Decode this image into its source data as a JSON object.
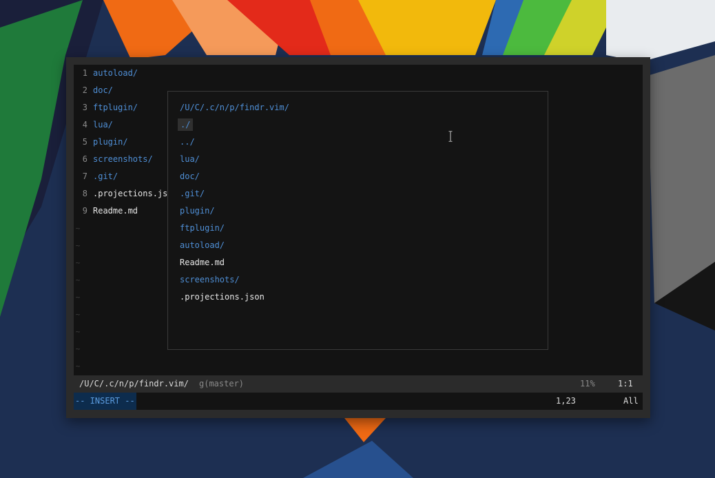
{
  "buffer": {
    "lines": [
      {
        "num": "1",
        "text": "autoload/",
        "kind": "dir"
      },
      {
        "num": "2",
        "text": "doc/",
        "kind": "dir"
      },
      {
        "num": "3",
        "text": "ftplugin/",
        "kind": "dir"
      },
      {
        "num": "4",
        "text": "lua/",
        "kind": "dir"
      },
      {
        "num": "5",
        "text": "plugin/",
        "kind": "dir"
      },
      {
        "num": "6",
        "text": "screenshots/",
        "kind": "dir"
      },
      {
        "num": "7",
        "text": ".git/",
        "kind": "dir"
      },
      {
        "num": "8",
        "text": ".projections.js",
        "kind": "file"
      },
      {
        "num": "9",
        "text": "Readme.md",
        "kind": "file"
      }
    ],
    "tilde": "~"
  },
  "picker": {
    "prompt": "/U/C/.c/n/p/findr.vim/",
    "items": [
      {
        "text": "./",
        "kind": "dir"
      },
      {
        "text": "../",
        "kind": "dir"
      },
      {
        "text": "lua/",
        "kind": "dir"
      },
      {
        "text": "doc/",
        "kind": "dir"
      },
      {
        "text": ".git/",
        "kind": "dir"
      },
      {
        "text": "plugin/",
        "kind": "dir"
      },
      {
        "text": "ftplugin/",
        "kind": "dir"
      },
      {
        "text": "autoload/",
        "kind": "dir"
      },
      {
        "text": "Readme.md",
        "kind": "file"
      },
      {
        "text": "screenshots/",
        "kind": "dir"
      },
      {
        "text": ".projections.json",
        "kind": "file"
      }
    ],
    "selected_index": 0
  },
  "statusline": {
    "path": "/U/C/.c/n/p/findr.vim/",
    "branch": "g(master)",
    "percent": "11%",
    "position": "1:1"
  },
  "cmdline": {
    "mode": "-- INSERT --",
    "position": "1,23",
    "scroll": "All"
  },
  "colors": {
    "directory": "#4f8fd6",
    "file": "#e6e6e6",
    "mode_bg": "#0d2c4d",
    "mode_fg": "#5c9de0"
  }
}
